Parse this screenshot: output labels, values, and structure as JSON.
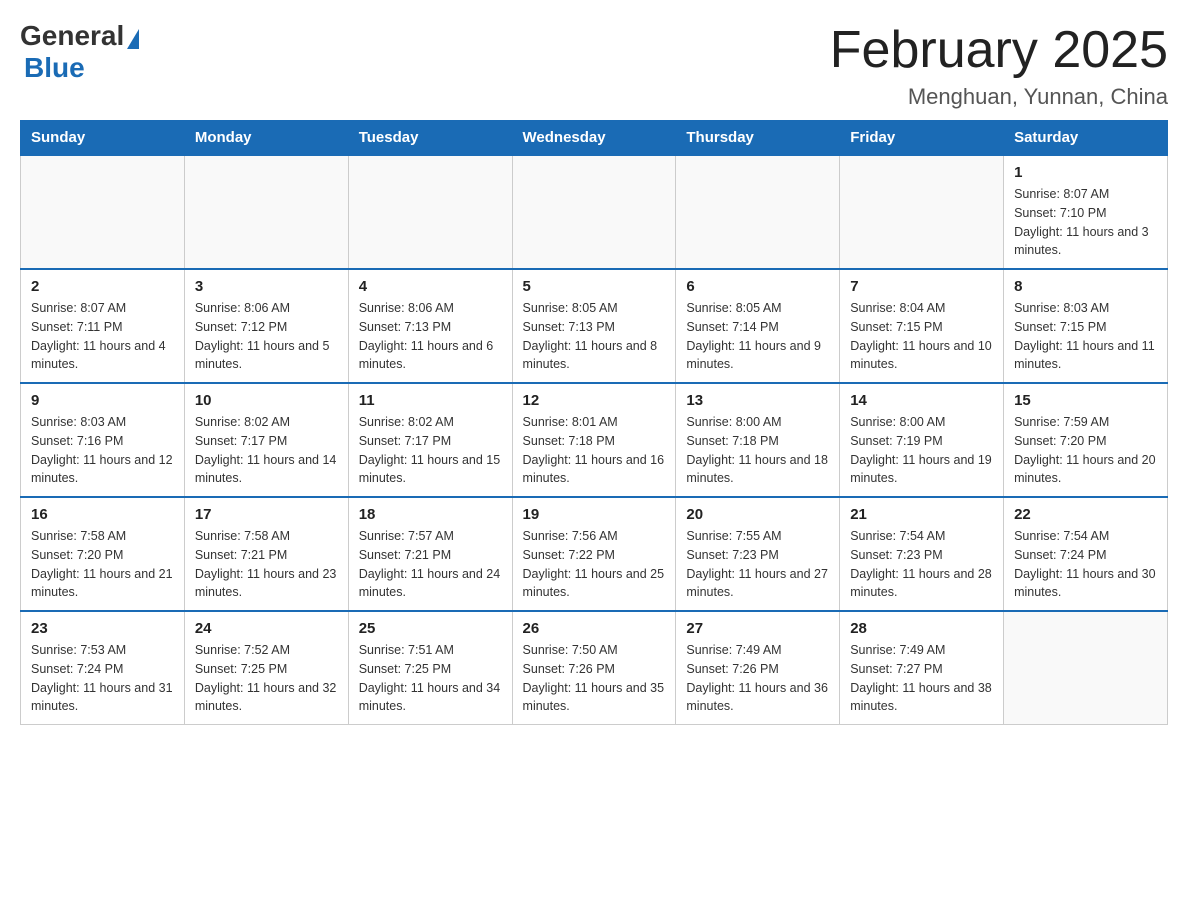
{
  "header": {
    "logo": {
      "general": "General",
      "arrow_symbol": "▶",
      "blue": "Blue"
    },
    "title": "February 2025",
    "location": "Menghuan, Yunnan, China"
  },
  "days_of_week": [
    "Sunday",
    "Monday",
    "Tuesday",
    "Wednesday",
    "Thursday",
    "Friday",
    "Saturday"
  ],
  "weeks": [
    {
      "days": [
        {
          "num": "",
          "sunrise": "",
          "sunset": "",
          "daylight": ""
        },
        {
          "num": "",
          "sunrise": "",
          "sunset": "",
          "daylight": ""
        },
        {
          "num": "",
          "sunrise": "",
          "sunset": "",
          "daylight": ""
        },
        {
          "num": "",
          "sunrise": "",
          "sunset": "",
          "daylight": ""
        },
        {
          "num": "",
          "sunrise": "",
          "sunset": "",
          "daylight": ""
        },
        {
          "num": "",
          "sunrise": "",
          "sunset": "",
          "daylight": ""
        },
        {
          "num": "1",
          "sunrise": "Sunrise: 8:07 AM",
          "sunset": "Sunset: 7:10 PM",
          "daylight": "Daylight: 11 hours and 3 minutes."
        }
      ]
    },
    {
      "days": [
        {
          "num": "2",
          "sunrise": "Sunrise: 8:07 AM",
          "sunset": "Sunset: 7:11 PM",
          "daylight": "Daylight: 11 hours and 4 minutes."
        },
        {
          "num": "3",
          "sunrise": "Sunrise: 8:06 AM",
          "sunset": "Sunset: 7:12 PM",
          "daylight": "Daylight: 11 hours and 5 minutes."
        },
        {
          "num": "4",
          "sunrise": "Sunrise: 8:06 AM",
          "sunset": "Sunset: 7:13 PM",
          "daylight": "Daylight: 11 hours and 6 minutes."
        },
        {
          "num": "5",
          "sunrise": "Sunrise: 8:05 AM",
          "sunset": "Sunset: 7:13 PM",
          "daylight": "Daylight: 11 hours and 8 minutes."
        },
        {
          "num": "6",
          "sunrise": "Sunrise: 8:05 AM",
          "sunset": "Sunset: 7:14 PM",
          "daylight": "Daylight: 11 hours and 9 minutes."
        },
        {
          "num": "7",
          "sunrise": "Sunrise: 8:04 AM",
          "sunset": "Sunset: 7:15 PM",
          "daylight": "Daylight: 11 hours and 10 minutes."
        },
        {
          "num": "8",
          "sunrise": "Sunrise: 8:03 AM",
          "sunset": "Sunset: 7:15 PM",
          "daylight": "Daylight: 11 hours and 11 minutes."
        }
      ]
    },
    {
      "days": [
        {
          "num": "9",
          "sunrise": "Sunrise: 8:03 AM",
          "sunset": "Sunset: 7:16 PM",
          "daylight": "Daylight: 11 hours and 12 minutes."
        },
        {
          "num": "10",
          "sunrise": "Sunrise: 8:02 AM",
          "sunset": "Sunset: 7:17 PM",
          "daylight": "Daylight: 11 hours and 14 minutes."
        },
        {
          "num": "11",
          "sunrise": "Sunrise: 8:02 AM",
          "sunset": "Sunset: 7:17 PM",
          "daylight": "Daylight: 11 hours and 15 minutes."
        },
        {
          "num": "12",
          "sunrise": "Sunrise: 8:01 AM",
          "sunset": "Sunset: 7:18 PM",
          "daylight": "Daylight: 11 hours and 16 minutes."
        },
        {
          "num": "13",
          "sunrise": "Sunrise: 8:00 AM",
          "sunset": "Sunset: 7:18 PM",
          "daylight": "Daylight: 11 hours and 18 minutes."
        },
        {
          "num": "14",
          "sunrise": "Sunrise: 8:00 AM",
          "sunset": "Sunset: 7:19 PM",
          "daylight": "Daylight: 11 hours and 19 minutes."
        },
        {
          "num": "15",
          "sunrise": "Sunrise: 7:59 AM",
          "sunset": "Sunset: 7:20 PM",
          "daylight": "Daylight: 11 hours and 20 minutes."
        }
      ]
    },
    {
      "days": [
        {
          "num": "16",
          "sunrise": "Sunrise: 7:58 AM",
          "sunset": "Sunset: 7:20 PM",
          "daylight": "Daylight: 11 hours and 21 minutes."
        },
        {
          "num": "17",
          "sunrise": "Sunrise: 7:58 AM",
          "sunset": "Sunset: 7:21 PM",
          "daylight": "Daylight: 11 hours and 23 minutes."
        },
        {
          "num": "18",
          "sunrise": "Sunrise: 7:57 AM",
          "sunset": "Sunset: 7:21 PM",
          "daylight": "Daylight: 11 hours and 24 minutes."
        },
        {
          "num": "19",
          "sunrise": "Sunrise: 7:56 AM",
          "sunset": "Sunset: 7:22 PM",
          "daylight": "Daylight: 11 hours and 25 minutes."
        },
        {
          "num": "20",
          "sunrise": "Sunrise: 7:55 AM",
          "sunset": "Sunset: 7:23 PM",
          "daylight": "Daylight: 11 hours and 27 minutes."
        },
        {
          "num": "21",
          "sunrise": "Sunrise: 7:54 AM",
          "sunset": "Sunset: 7:23 PM",
          "daylight": "Daylight: 11 hours and 28 minutes."
        },
        {
          "num": "22",
          "sunrise": "Sunrise: 7:54 AM",
          "sunset": "Sunset: 7:24 PM",
          "daylight": "Daylight: 11 hours and 30 minutes."
        }
      ]
    },
    {
      "days": [
        {
          "num": "23",
          "sunrise": "Sunrise: 7:53 AM",
          "sunset": "Sunset: 7:24 PM",
          "daylight": "Daylight: 11 hours and 31 minutes."
        },
        {
          "num": "24",
          "sunrise": "Sunrise: 7:52 AM",
          "sunset": "Sunset: 7:25 PM",
          "daylight": "Daylight: 11 hours and 32 minutes."
        },
        {
          "num": "25",
          "sunrise": "Sunrise: 7:51 AM",
          "sunset": "Sunset: 7:25 PM",
          "daylight": "Daylight: 11 hours and 34 minutes."
        },
        {
          "num": "26",
          "sunrise": "Sunrise: 7:50 AM",
          "sunset": "Sunset: 7:26 PM",
          "daylight": "Daylight: 11 hours and 35 minutes."
        },
        {
          "num": "27",
          "sunrise": "Sunrise: 7:49 AM",
          "sunset": "Sunset: 7:26 PM",
          "daylight": "Daylight: 11 hours and 36 minutes."
        },
        {
          "num": "28",
          "sunrise": "Sunrise: 7:49 AM",
          "sunset": "Sunset: 7:27 PM",
          "daylight": "Daylight: 11 hours and 38 minutes."
        },
        {
          "num": "",
          "sunrise": "",
          "sunset": "",
          "daylight": ""
        }
      ]
    }
  ]
}
